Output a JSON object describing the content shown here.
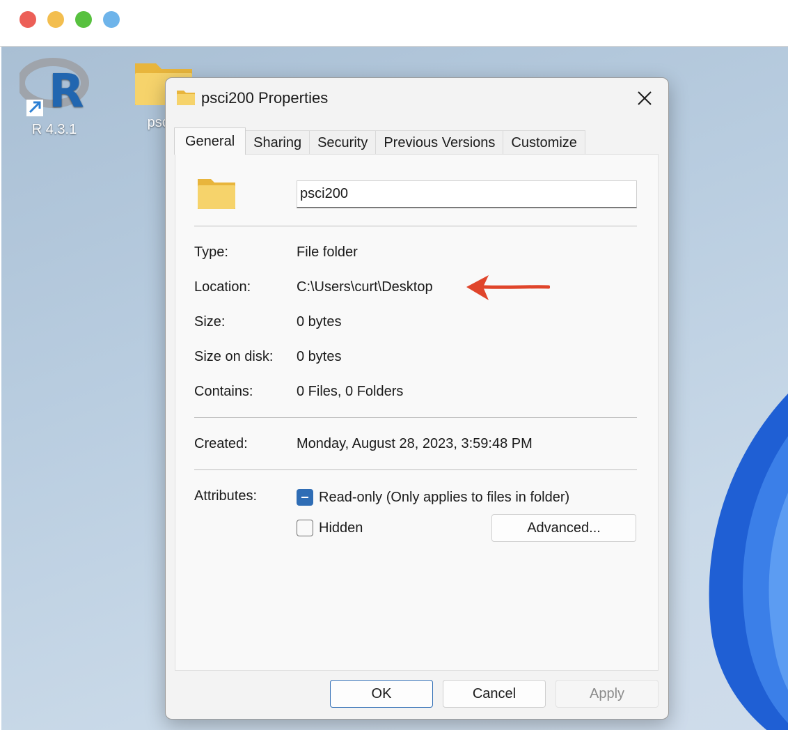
{
  "desktop": {
    "icons": [
      {
        "label": "R 4.3.1"
      },
      {
        "label": "psci2"
      }
    ]
  },
  "dialog": {
    "title": "psci200 Properties",
    "tabs": [
      {
        "label": "General",
        "active": true
      },
      {
        "label": "Sharing"
      },
      {
        "label": "Security"
      },
      {
        "label": "Previous Versions"
      },
      {
        "label": "Customize"
      }
    ],
    "name_value": "psci200",
    "properties": {
      "type_label": "Type:",
      "type_value": "File folder",
      "location_label": "Location:",
      "location_value": "C:\\Users\\curt\\Desktop",
      "size_label": "Size:",
      "size_value": "0 bytes",
      "size_on_disk_label": "Size on disk:",
      "size_on_disk_value": "0 bytes",
      "contains_label": "Contains:",
      "contains_value": "0 Files, 0 Folders",
      "created_label": "Created:",
      "created_value": "Monday, August 28, 2023, 3:59:48 PM"
    },
    "attributes": {
      "label": "Attributes:",
      "readonly_label": "Read-only (Only applies to files in folder)",
      "readonly_state": "indeterminate",
      "hidden_label": "Hidden",
      "hidden_state": "unchecked",
      "advanced_label": "Advanced..."
    },
    "buttons": {
      "ok": "OK",
      "cancel": "Cancel",
      "apply": "Apply"
    }
  },
  "colors": {
    "traffic_red": "#ec5f57",
    "traffic_yellow": "#f3be4f",
    "traffic_green": "#58c13f",
    "traffic_blue": "#6eb4ea",
    "accent": "#2f6db5",
    "annotation_arrow": "#e0452b",
    "folder_yellow": "#f6d36b"
  }
}
